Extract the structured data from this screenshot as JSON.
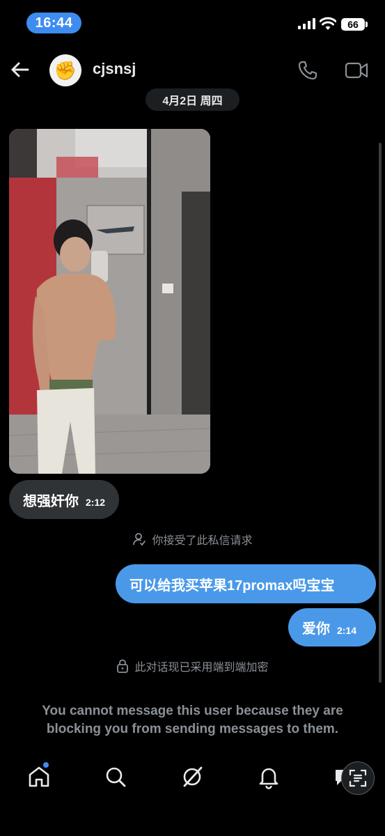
{
  "status_bar": {
    "time": "16:44",
    "battery": "66"
  },
  "header": {
    "username": "cjsnsj",
    "avatar_emoji": "✊",
    "icons": [
      "back-arrow-icon",
      "phone-icon",
      "video-camera-icon"
    ]
  },
  "conversation": {
    "date_label": "4月2日 周四",
    "messages": [
      {
        "from": "them",
        "type": "image"
      },
      {
        "from": "them",
        "text": "想强奸你",
        "time": "2:12"
      },
      {
        "from": "system",
        "text": "你接受了此私信请求"
      },
      {
        "from": "me",
        "text": "可以给我买苹果17promax吗宝宝"
      },
      {
        "from": "me",
        "text": "爱你",
        "time": "2:14"
      },
      {
        "from": "system",
        "text": "此对话现已采用端到端加密"
      }
    ],
    "block_notice": "You cannot message this user because they are blocking you from sending messages to them."
  },
  "bottom_nav": {
    "items": [
      "home-icon",
      "search-icon",
      "grok-icon",
      "notifications-icon",
      "messages-icon"
    ],
    "home_has_dot": true
  },
  "colors": {
    "accent": "#4a99e9",
    "incoming_bubble": "#2f3336",
    "time_pill": "#3e8cf0"
  }
}
